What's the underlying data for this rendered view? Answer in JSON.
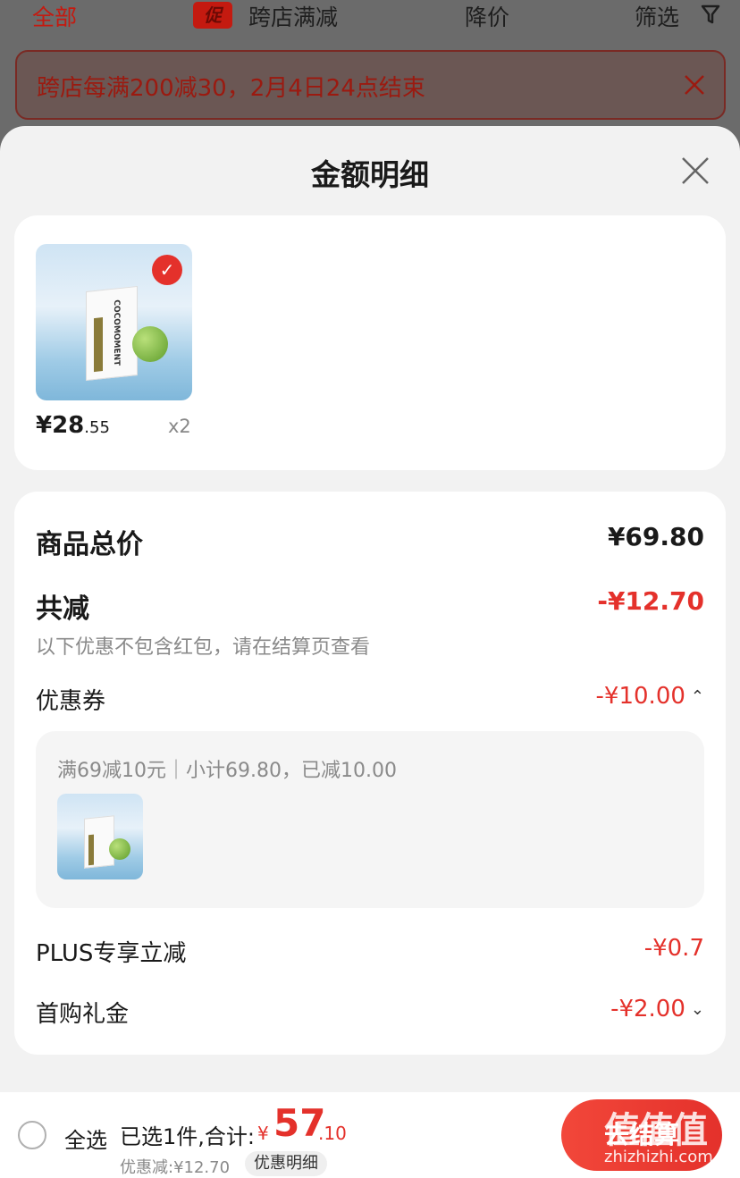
{
  "top_bar": {
    "all_label": "全部",
    "promo_tag": "促",
    "cross_store_label": "跨店满减",
    "price_drop_label": "降价",
    "filter_label": "筛选"
  },
  "promo_banner": {
    "text": "跨店每满200减30，2月4日24点结束"
  },
  "sheet": {
    "title": "金额明细"
  },
  "product": {
    "brand_text": "COCOMOMENT",
    "price_int": "¥28",
    "price_dec": ".55",
    "quantity": "x2"
  },
  "detail": {
    "total_label": "商品总价",
    "total_value": "¥69.80",
    "reduce_label": "共减",
    "reduce_value": "-¥12.70",
    "note": "以下优惠不包含红包，请在结算页查看",
    "coupon_label": "优惠券",
    "coupon_value": "-¥10.00",
    "coupon_desc": "满69减10元｜小计69.80，已减10.00",
    "plus_label": "PLUS专享立减",
    "plus_value": "-¥0.7",
    "first_label": "首购礼金",
    "first_value": "-¥2.00"
  },
  "bottom_bar": {
    "select_all": "全选",
    "selected_info": "已选1件,合计:",
    "sum_yen": "¥",
    "sum_int": "57",
    "sum_dec": ".10",
    "discount_line": "优惠减:¥12.70",
    "detail_pill": "优惠明细",
    "checkout_label": "去结算"
  },
  "watermark": {
    "big": "值值值",
    "small": "zhizhizhi.com"
  },
  "colors": {
    "accent": "#e4312b",
    "sheet_bg": "#f2f2f2",
    "overlay": "#6b6b6b"
  }
}
